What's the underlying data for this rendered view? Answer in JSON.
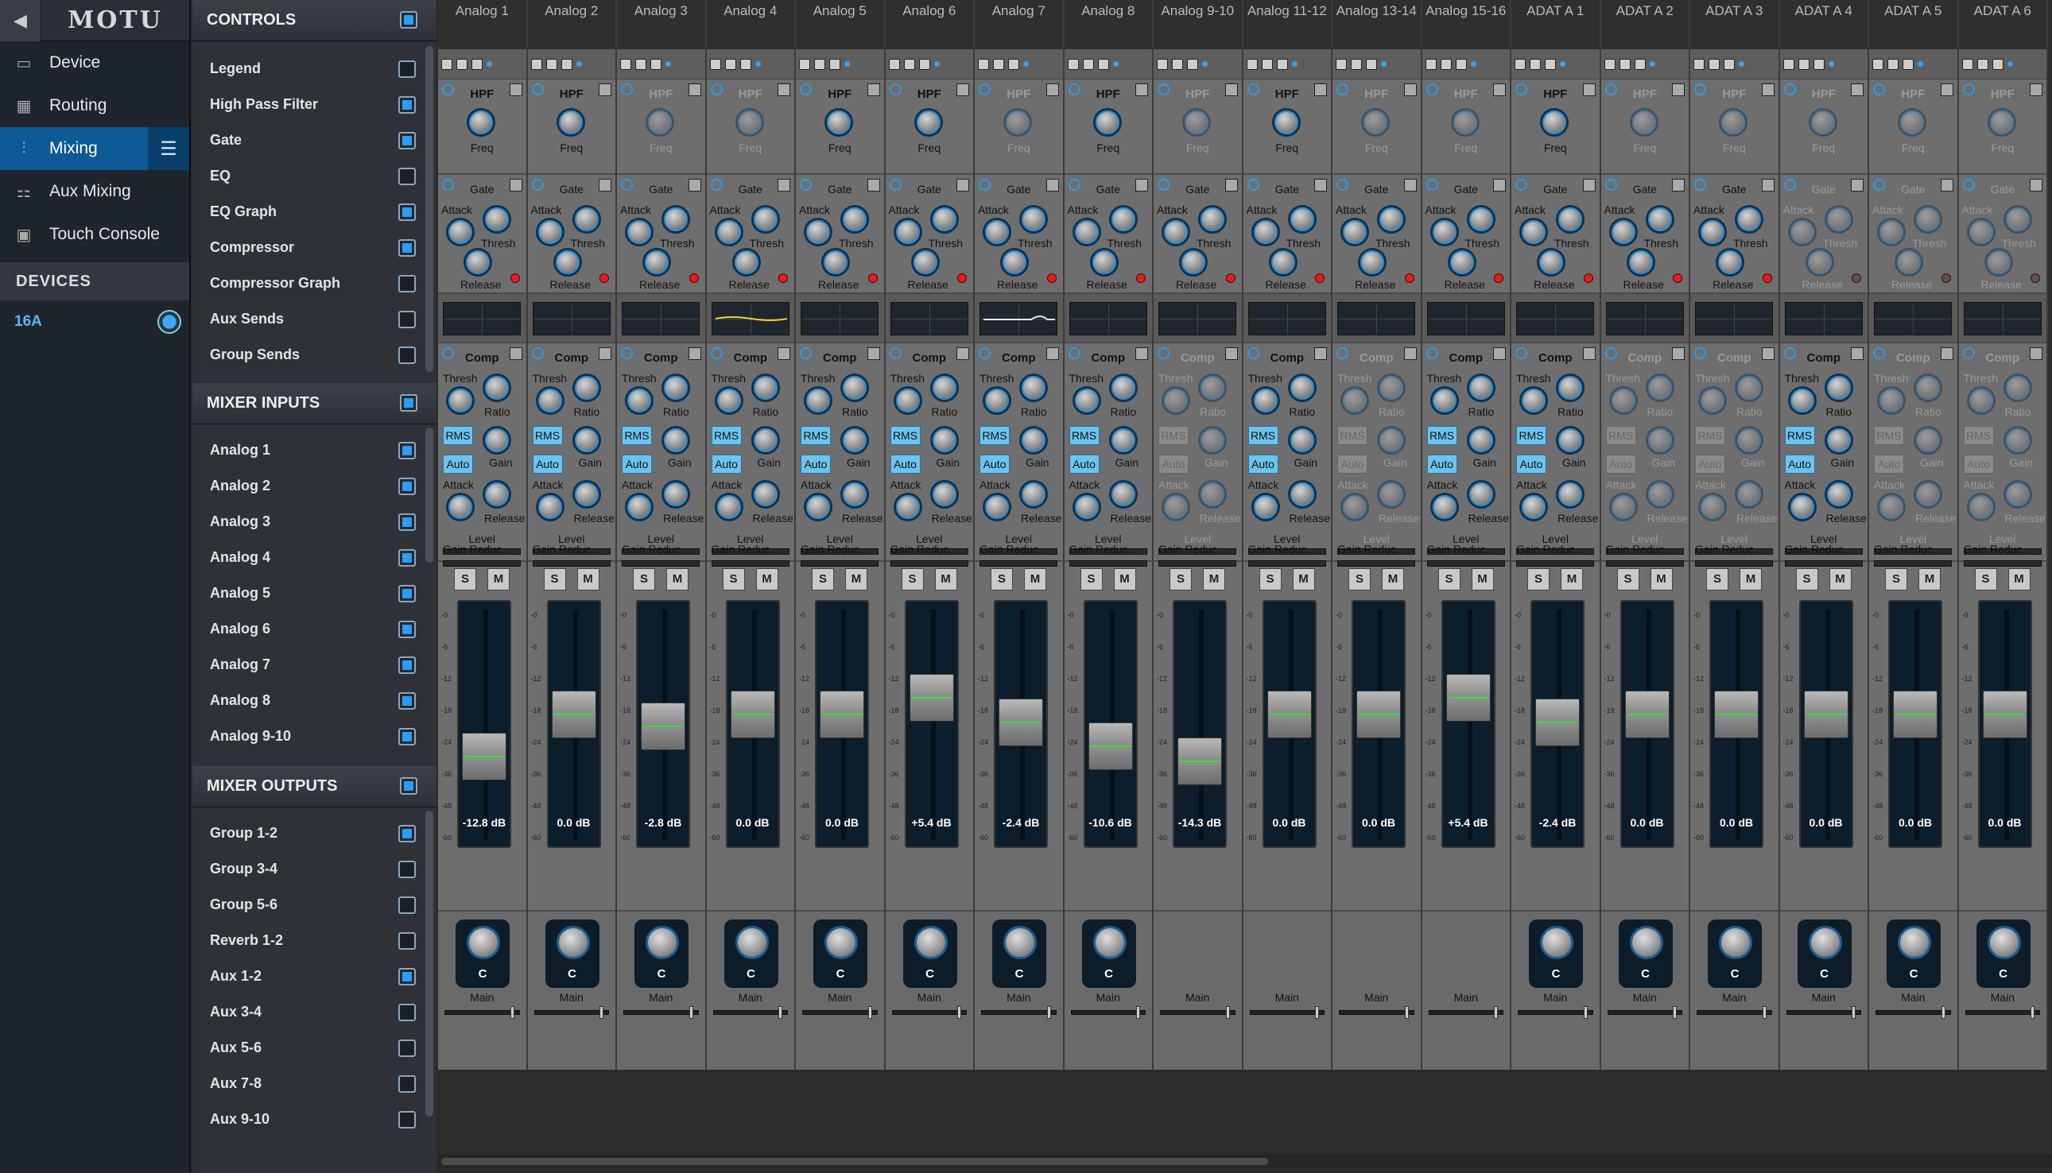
{
  "app": {
    "logo": "MOTU"
  },
  "nav": {
    "items": [
      {
        "label": "Device",
        "icon": "device-icon"
      },
      {
        "label": "Routing",
        "icon": "routing-grid-icon"
      },
      {
        "label": "Mixing",
        "icon": "mixer-sliders-icon",
        "active": true
      },
      {
        "label": "Aux Mixing",
        "icon": "aux-mixing-icon"
      },
      {
        "label": "Touch Console",
        "icon": "touch-console-icon"
      }
    ],
    "devices_header": "DEVICES",
    "device": "16A"
  },
  "controls": {
    "title": "CONTROLS",
    "items": [
      {
        "label": "Legend",
        "checked": false
      },
      {
        "label": "High Pass Filter",
        "checked": true
      },
      {
        "label": "Gate",
        "checked": true
      },
      {
        "label": "EQ",
        "checked": false
      },
      {
        "label": "EQ Graph",
        "checked": true
      },
      {
        "label": "Compressor",
        "checked": true
      },
      {
        "label": "Compressor Graph",
        "checked": false
      },
      {
        "label": "Aux Sends",
        "checked": false
      },
      {
        "label": "Group Sends",
        "checked": false
      }
    ]
  },
  "inputs": {
    "title": "MIXER INPUTS",
    "items": [
      {
        "label": "Analog 1",
        "checked": true
      },
      {
        "label": "Analog 2",
        "checked": true
      },
      {
        "label": "Analog 3",
        "checked": true
      },
      {
        "label": "Analog 4",
        "checked": true
      },
      {
        "label": "Analog 5",
        "checked": true
      },
      {
        "label": "Analog 6",
        "checked": true
      },
      {
        "label": "Analog 7",
        "checked": true
      },
      {
        "label": "Analog 8",
        "checked": true
      },
      {
        "label": "Analog 9-10",
        "checked": true
      }
    ]
  },
  "outputs": {
    "title": "MIXER OUTPUTS",
    "items": [
      {
        "label": "Group 1-2",
        "checked": true
      },
      {
        "label": "Group 3-4",
        "checked": false
      },
      {
        "label": "Group 5-6",
        "checked": false
      },
      {
        "label": "Reverb 1-2",
        "checked": false
      },
      {
        "label": "Aux 1-2",
        "checked": true
      },
      {
        "label": "Aux 3-4",
        "checked": false
      },
      {
        "label": "Aux 5-6",
        "checked": false
      },
      {
        "label": "Aux 7-8",
        "checked": false
      },
      {
        "label": "Aux 9-10",
        "checked": false
      }
    ]
  },
  "labels": {
    "hpf": "HPF",
    "freq": "Freq",
    "gate": "Gate",
    "attack": "Attack",
    "thresh": "Thresh",
    "release": "Release",
    "comp": "Comp",
    "ratio": "Ratio",
    "rms": "RMS",
    "auto": "Auto",
    "gain": "Gain",
    "level": "Level",
    "gain_reduction": "Gain Reduc...",
    "solo": "S",
    "mute": "M",
    "pan": "C",
    "send": "Main",
    "scale": [
      "-0",
      "-6",
      "-12",
      "-18",
      "-24",
      "-36",
      "-48",
      "-60"
    ]
  },
  "strips": [
    {
      "name": "Analog 1",
      "db": "-12.8 dB",
      "fader_level": 0.27,
      "hpf": true,
      "gate": true,
      "comp": true,
      "pan": true,
      "eq": "flat"
    },
    {
      "name": "Analog 2",
      "db": "0.0 dB",
      "fader_level": 0.52,
      "hpf": true,
      "gate": true,
      "comp": true,
      "pan": true,
      "eq": "flat"
    },
    {
      "name": "Analog 3",
      "db": "-2.8 dB",
      "fader_level": 0.45,
      "hpf": false,
      "gate": true,
      "comp": true,
      "pan": true,
      "eq": "flat"
    },
    {
      "name": "Analog 4",
      "db": "0.0 dB",
      "fader_level": 0.52,
      "hpf": false,
      "gate": true,
      "comp": true,
      "pan": true,
      "eq": "yellow"
    },
    {
      "name": "Analog 5",
      "db": "0.0 dB",
      "fader_level": 0.52,
      "hpf": true,
      "gate": true,
      "comp": true,
      "pan": true,
      "eq": "flat"
    },
    {
      "name": "Analog 6",
      "db": "+5.4 dB",
      "fader_level": 0.62,
      "hpf": true,
      "gate": true,
      "comp": true,
      "pan": true,
      "eq": "flat"
    },
    {
      "name": "Analog 7",
      "db": "-2.4 dB",
      "fader_level": 0.47,
      "hpf": false,
      "gate": true,
      "comp": true,
      "pan": true,
      "eq": "white"
    },
    {
      "name": "Analog 8",
      "db": "-10.6 dB",
      "fader_level": 0.33,
      "hpf": true,
      "gate": true,
      "comp": true,
      "pan": true,
      "eq": "flat"
    },
    {
      "name": "Analog 9-10",
      "db": "-14.3 dB",
      "fader_level": 0.24,
      "hpf": false,
      "gate": true,
      "comp": false,
      "pan": false,
      "eq": "flat"
    },
    {
      "name": "Analog 11-12",
      "db": "0.0 dB",
      "fader_level": 0.52,
      "hpf": true,
      "gate": true,
      "comp": true,
      "pan": false,
      "eq": "flat"
    },
    {
      "name": "Analog 13-14",
      "db": "0.0 dB",
      "fader_level": 0.52,
      "hpf": false,
      "gate": true,
      "comp": false,
      "pan": false,
      "eq": "flat"
    },
    {
      "name": "Analog 15-16",
      "db": "+5.4 dB",
      "fader_level": 0.62,
      "hpf": false,
      "gate": true,
      "comp": true,
      "pan": false,
      "eq": "flat"
    },
    {
      "name": "ADAT A 1",
      "db": "-2.4 dB",
      "fader_level": 0.47,
      "hpf": true,
      "gate": true,
      "comp": true,
      "pan": true,
      "eq": "flat"
    },
    {
      "name": "ADAT A 2",
      "db": "0.0 dB",
      "fader_level": 0.52,
      "hpf": false,
      "gate": true,
      "comp": false,
      "pan": true,
      "eq": "flat"
    },
    {
      "name": "ADAT A 3",
      "db": "0.0 dB",
      "fader_level": 0.52,
      "hpf": false,
      "gate": true,
      "comp": false,
      "pan": true,
      "eq": "flat"
    },
    {
      "name": "ADAT A 4",
      "db": "0.0 dB",
      "fader_level": 0.52,
      "hpf": false,
      "gate": false,
      "comp": true,
      "pan": true,
      "eq": "flat"
    },
    {
      "name": "ADAT A 5",
      "db": "0.0 dB",
      "fader_level": 0.52,
      "hpf": false,
      "gate": false,
      "comp": false,
      "pan": true,
      "eq": "flat"
    },
    {
      "name": "ADAT A 6",
      "db": "0.0 dB",
      "fader_level": 0.52,
      "hpf": false,
      "gate": false,
      "comp": false,
      "pan": true,
      "eq": "flat"
    }
  ]
}
